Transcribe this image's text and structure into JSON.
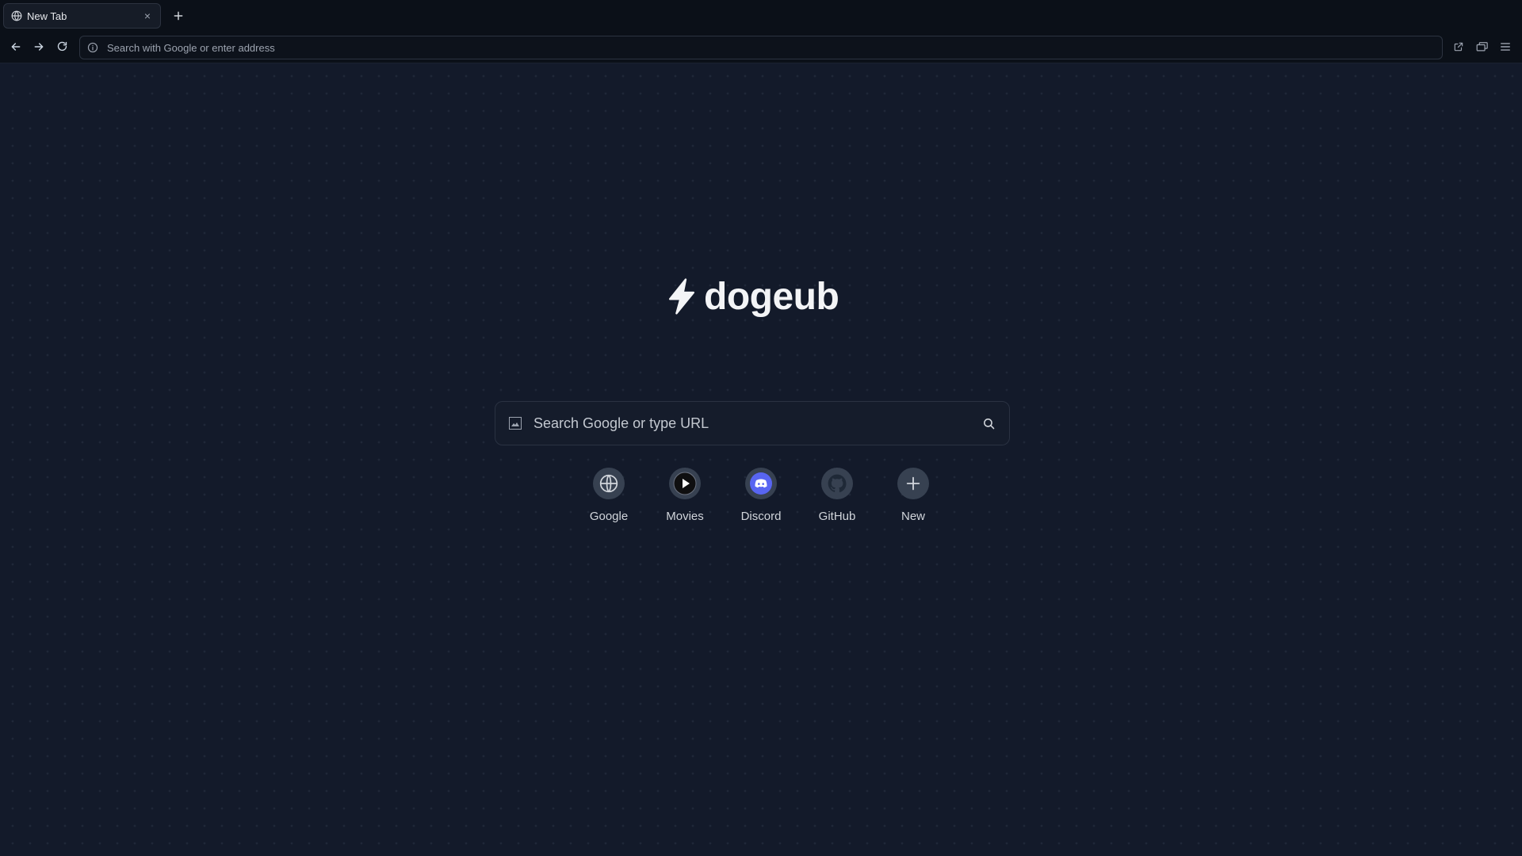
{
  "browser": {
    "tab": {
      "title": "New Tab",
      "close_symbol": "×"
    },
    "new_tab_symbol": "+",
    "address_bar": {
      "placeholder": "Search with Google or enter address",
      "value": ""
    },
    "nav_icons": [
      "back-arrow-icon",
      "forward-arrow-icon",
      "reload-icon"
    ],
    "right_icons": [
      "open-external-icon",
      "windows-icon",
      "hamburger-menu-icon"
    ]
  },
  "page": {
    "logo": {
      "text": "dogeub",
      "icon": "lightning-bolt-icon"
    },
    "search": {
      "placeholder": "Search Google or type URL",
      "value": ""
    },
    "shortcuts": [
      {
        "label": "Google",
        "icon": "globe-icon"
      },
      {
        "label": "Movies",
        "icon": "play-icon"
      },
      {
        "label": "Discord",
        "icon": "discord-icon"
      },
      {
        "label": "GitHub",
        "icon": "github-icon"
      },
      {
        "label": "New",
        "icon": "plus-icon"
      }
    ]
  },
  "colors": {
    "background": "#131a2a",
    "chrome": "#0b1018",
    "text": "#d1d5db",
    "discord": "#5865f2"
  }
}
